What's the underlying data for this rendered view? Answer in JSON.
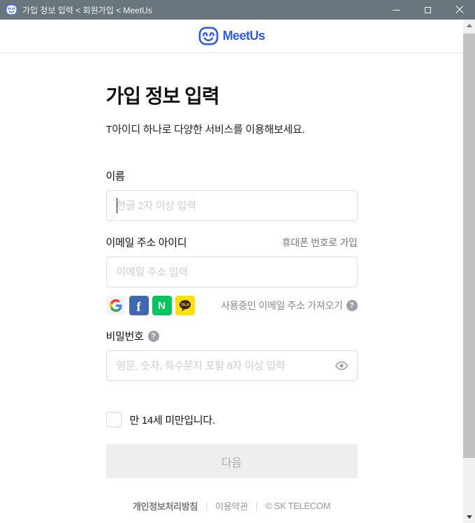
{
  "window": {
    "title": "가입 정보 입력 < 회원가입 < MeetUs"
  },
  "header": {
    "logo_text": "MeetUs"
  },
  "form": {
    "title": "가입 정보 입력",
    "subtitle": "T아이디 하나로 다양한 서비스를 이용해보세요.",
    "name_label": "이름",
    "name_placeholder": "한글 2자 이상 입력",
    "email_label": "이메일 주소 아이디",
    "phone_signup_link": "휴대폰 번호로 가입",
    "email_placeholder": "이메일 주소 입력",
    "fetch_email_label": "사용중인 이메일 주소 가져오기",
    "help_glyph": "?",
    "password_label": "비밀번호",
    "password_placeholder": "영문, 숫자, 특수문자 포함 8자 이상 입력",
    "under14_label": "만 14세 미만입니다.",
    "next_button": "다음"
  },
  "social": {
    "facebook_letter": "f",
    "naver_letter": "N",
    "kakao_text": "TALK"
  },
  "footer": {
    "privacy": "개인정보처리방침",
    "terms": "이용약관",
    "copyright": "© SK TELECOM",
    "separator": "|"
  },
  "colors": {
    "titlebar": "#68757d",
    "brand_blue": "#2d5bf0",
    "facebook_blue": "#4267b2",
    "naver_green": "#03c75a",
    "kakao_yellow": "#fae100",
    "next_disabled_bg": "#eeeeee",
    "next_disabled_text": "#b0b0b0"
  }
}
